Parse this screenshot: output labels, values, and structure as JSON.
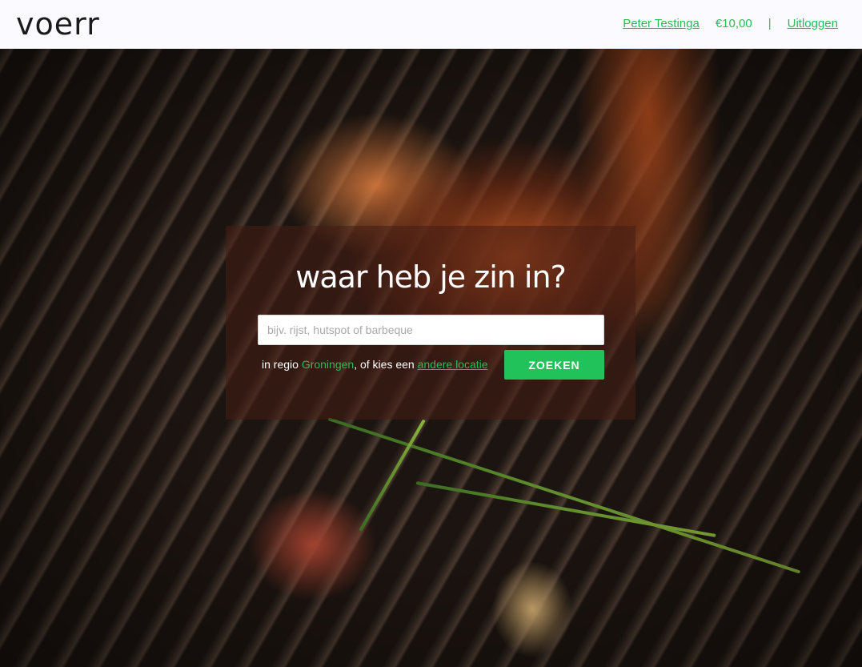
{
  "header": {
    "logo": "voerr",
    "user_name": "Peter Testinga",
    "balance": "€10,00",
    "separator": "|",
    "logout_label": "Uitloggen"
  },
  "search": {
    "heading": "waar heb je zin in?",
    "placeholder": "bijv. rijst, hutspot of barbeque",
    "value": "",
    "region_prefix": "in regio",
    "region_name": "Groningen",
    "region_middle": ", of kies een",
    "other_location_link": "andere locatie",
    "button_label": "ZOEKEN"
  },
  "colors": {
    "accent": "#22c25a",
    "link": "#2dbb58",
    "header_bg": "#fafaff"
  }
}
